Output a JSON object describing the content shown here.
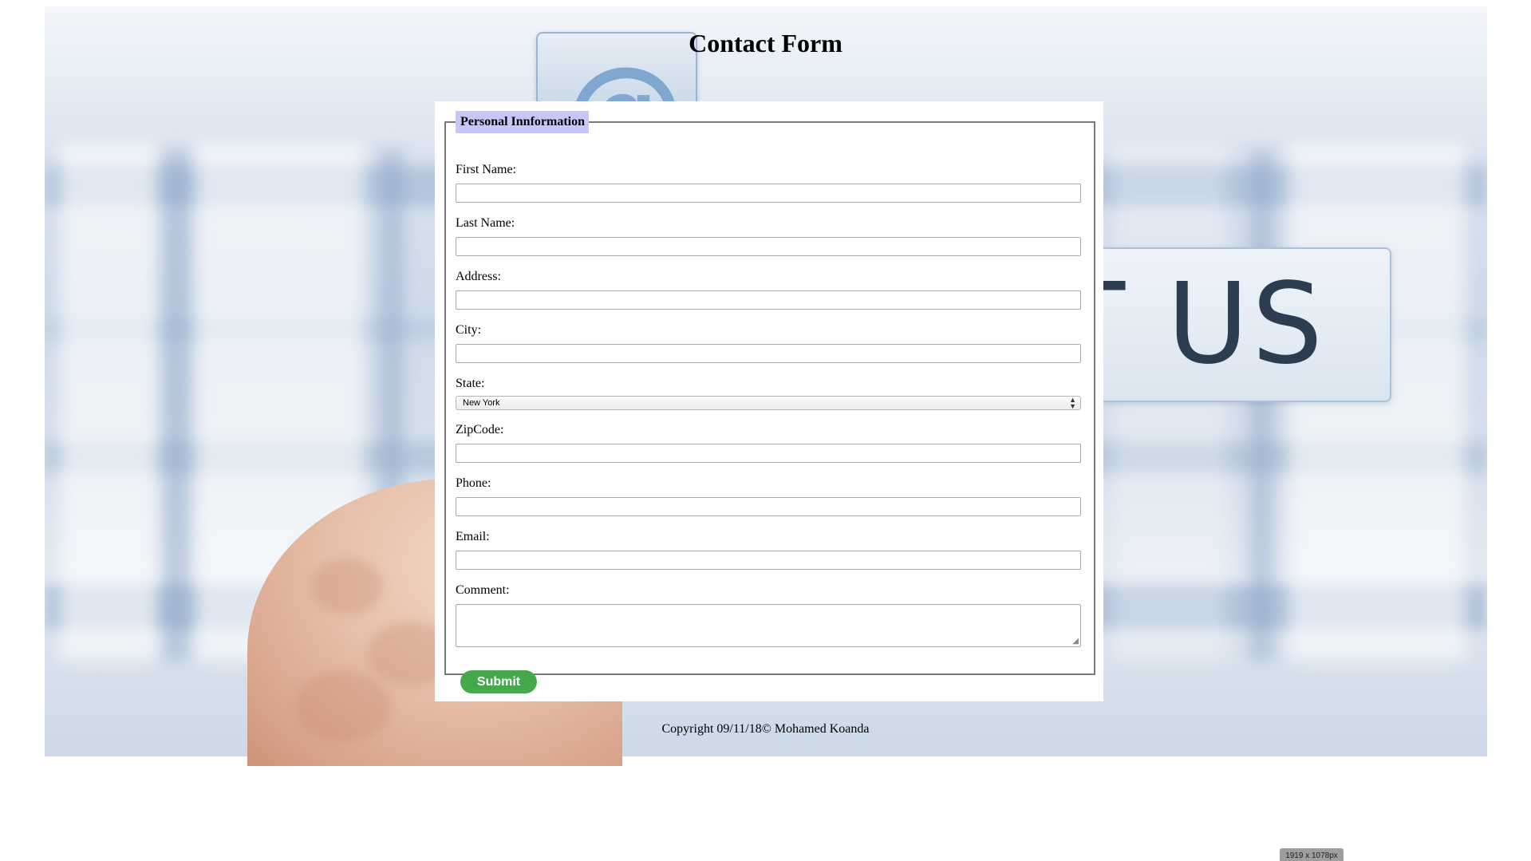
{
  "page": {
    "title": "Contact Form",
    "copyright": "Copyright 09/11/18© Mohamed Koanda"
  },
  "background": {
    "tile_at_symbol": "@",
    "tile_text": "CT US",
    "accent_color": "#7fa7cf"
  },
  "form": {
    "legend": "Personal Innformation",
    "fields": {
      "first_name": {
        "label": "First Name:",
        "value": ""
      },
      "last_name": {
        "label": "Last Name:",
        "value": ""
      },
      "address": {
        "label": "Address:",
        "value": ""
      },
      "city": {
        "label": "City:",
        "value": ""
      },
      "state": {
        "label": "State:",
        "selected": "New York"
      },
      "zipcode": {
        "label": "ZipCode:",
        "value": ""
      },
      "phone": {
        "label": "Phone:",
        "value": ""
      },
      "email": {
        "label": "Email:",
        "value": ""
      },
      "comment": {
        "label": "Comment:",
        "value": ""
      }
    },
    "submit_label": "Submit",
    "submit_color": "#46a84c",
    "legend_color": "#c7c7f7"
  },
  "overlay": {
    "dimensions_badge": "1919 x 1078px"
  }
}
